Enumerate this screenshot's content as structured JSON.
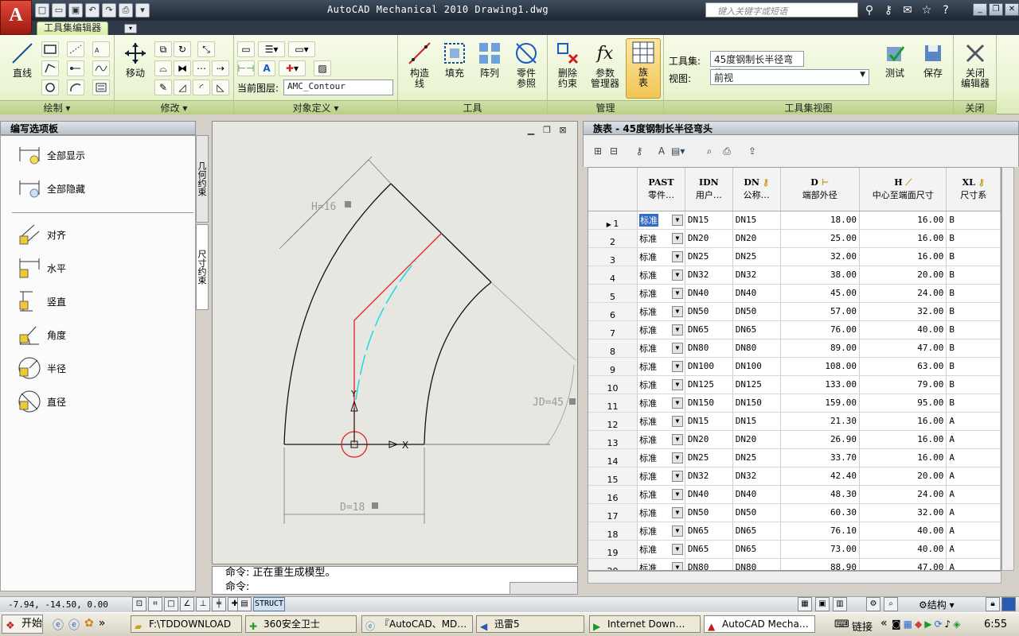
{
  "app": {
    "title": "AutoCAD Mechanical 2010  Drawing1.dwg",
    "logo_letter": "A",
    "logo_sub": "M"
  },
  "search": {
    "placeholder": "键入关键字或短语"
  },
  "ribbon": {
    "tab_active": "工具集编辑器",
    "panels": {
      "draw": "绘制",
      "modify": "修改",
      "objdef": "对象定义",
      "tools": "工具",
      "manage": "管理",
      "view": "工具集视图",
      "close": "关闭"
    },
    "buttons": {
      "line": "直线",
      "move": "移动",
      "construct": "构造\n线",
      "fill": "填充",
      "array": "阵列",
      "part_ref": "零件\n参照",
      "delete_constraint": "删除\n约束",
      "param_manager": "参数\n管理器",
      "family_table": "族\n表",
      "test": "测试",
      "save": "保存",
      "close_editor": "关闭\n编辑器"
    },
    "current_layer_label": "当前图层:",
    "current_layer": "AMC_Contour",
    "toolset_label": "工具集:",
    "toolset_value": "45度钢制长半径弯头",
    "view_label": "视图:",
    "view_value": "前视"
  },
  "palette": {
    "title": "编写选项板",
    "tabs": [
      "几何约束",
      "尺寸约束"
    ],
    "items": [
      "全部显示",
      "全部隐藏",
      "对齐",
      "水平",
      "竖直",
      "角度",
      "半径",
      "直径"
    ]
  },
  "drawing": {
    "dim_h": "H=16",
    "dim_jd": "JD=45",
    "dim_d": "D=18",
    "axis_x": "X",
    "axis_y": "Y"
  },
  "command": {
    "line1": "命令: 正在重生成模型。",
    "line2": "命令:"
  },
  "family_table": {
    "title": "族表 - 45度钢制长半径弯头",
    "columns": [
      {
        "code": "PAST",
        "label": "零件…"
      },
      {
        "code": "IDN",
        "label": "用户…"
      },
      {
        "code": "DN",
        "label": "公称…"
      },
      {
        "code": "D",
        "label": "端部外径"
      },
      {
        "code": "H",
        "label": "中心至端面尺寸"
      },
      {
        "code": "XL",
        "label": "尺寸系"
      }
    ],
    "rows": [
      {
        "n": "1",
        "past": "标准",
        "idn": "DN15",
        "dn": "DN15",
        "d": "18.00",
        "h": "16.00",
        "xl": "B"
      },
      {
        "n": "2",
        "past": "标准",
        "idn": "DN20",
        "dn": "DN20",
        "d": "25.00",
        "h": "16.00",
        "xl": "B"
      },
      {
        "n": "3",
        "past": "标准",
        "idn": "DN25",
        "dn": "DN25",
        "d": "32.00",
        "h": "16.00",
        "xl": "B"
      },
      {
        "n": "4",
        "past": "标准",
        "idn": "DN32",
        "dn": "DN32",
        "d": "38.00",
        "h": "20.00",
        "xl": "B"
      },
      {
        "n": "5",
        "past": "标准",
        "idn": "DN40",
        "dn": "DN40",
        "d": "45.00",
        "h": "24.00",
        "xl": "B"
      },
      {
        "n": "6",
        "past": "标准",
        "idn": "DN50",
        "dn": "DN50",
        "d": "57.00",
        "h": "32.00",
        "xl": "B"
      },
      {
        "n": "7",
        "past": "标准",
        "idn": "DN65",
        "dn": "DN65",
        "d": "76.00",
        "h": "40.00",
        "xl": "B"
      },
      {
        "n": "8",
        "past": "标准",
        "idn": "DN80",
        "dn": "DN80",
        "d": "89.00",
        "h": "47.00",
        "xl": "B"
      },
      {
        "n": "9",
        "past": "标准",
        "idn": "DN100",
        "dn": "DN100",
        "d": "108.00",
        "h": "63.00",
        "xl": "B"
      },
      {
        "n": "10",
        "past": "标准",
        "idn": "DN125",
        "dn": "DN125",
        "d": "133.00",
        "h": "79.00",
        "xl": "B"
      },
      {
        "n": "11",
        "past": "标准",
        "idn": "DN150",
        "dn": "DN150",
        "d": "159.00",
        "h": "95.00",
        "xl": "B"
      },
      {
        "n": "12",
        "past": "标准",
        "idn": "DN15",
        "dn": "DN15",
        "d": "21.30",
        "h": "16.00",
        "xl": "A"
      },
      {
        "n": "13",
        "past": "标准",
        "idn": "DN20",
        "dn": "DN20",
        "d": "26.90",
        "h": "16.00",
        "xl": "A"
      },
      {
        "n": "14",
        "past": "标准",
        "idn": "DN25",
        "dn": "DN25",
        "d": "33.70",
        "h": "16.00",
        "xl": "A"
      },
      {
        "n": "15",
        "past": "标准",
        "idn": "DN32",
        "dn": "DN32",
        "d": "42.40",
        "h": "20.00",
        "xl": "A"
      },
      {
        "n": "16",
        "past": "标准",
        "idn": "DN40",
        "dn": "DN40",
        "d": "48.30",
        "h": "24.00",
        "xl": "A"
      },
      {
        "n": "17",
        "past": "标准",
        "idn": "DN50",
        "dn": "DN50",
        "d": "60.30",
        "h": "32.00",
        "xl": "A"
      },
      {
        "n": "18",
        "past": "标准",
        "idn": "DN65",
        "dn": "DN65",
        "d": "76.10",
        "h": "40.00",
        "xl": "A"
      },
      {
        "n": "19",
        "past": "标准",
        "idn": "DN65",
        "dn": "DN65",
        "d": "73.00",
        "h": "40.00",
        "xl": "A"
      },
      {
        "n": "20",
        "past": "标准",
        "idn": "DN80",
        "dn": "DN80",
        "d": "88.90",
        "h": "47.00",
        "xl": "A"
      }
    ]
  },
  "statusbar": {
    "coords": "-7.94, -14.50, 0.00",
    "struct": "STRUCT",
    "structure_menu": "结构"
  },
  "taskbar": {
    "start": "开始",
    "tasks": [
      "F:\\TDDOWNLOAD",
      "360安全卫士",
      "『AutoCAD、MD…",
      "迅雷5",
      "Internet Down…",
      "AutoCAD Mecha…"
    ],
    "link_label": "链接",
    "clock": "6:55"
  },
  "colors": {
    "ribbon_green": "#dcebb9",
    "selection_blue": "#3169c6",
    "red_line": "#e02020",
    "cyan_line": "#22d4e6"
  }
}
